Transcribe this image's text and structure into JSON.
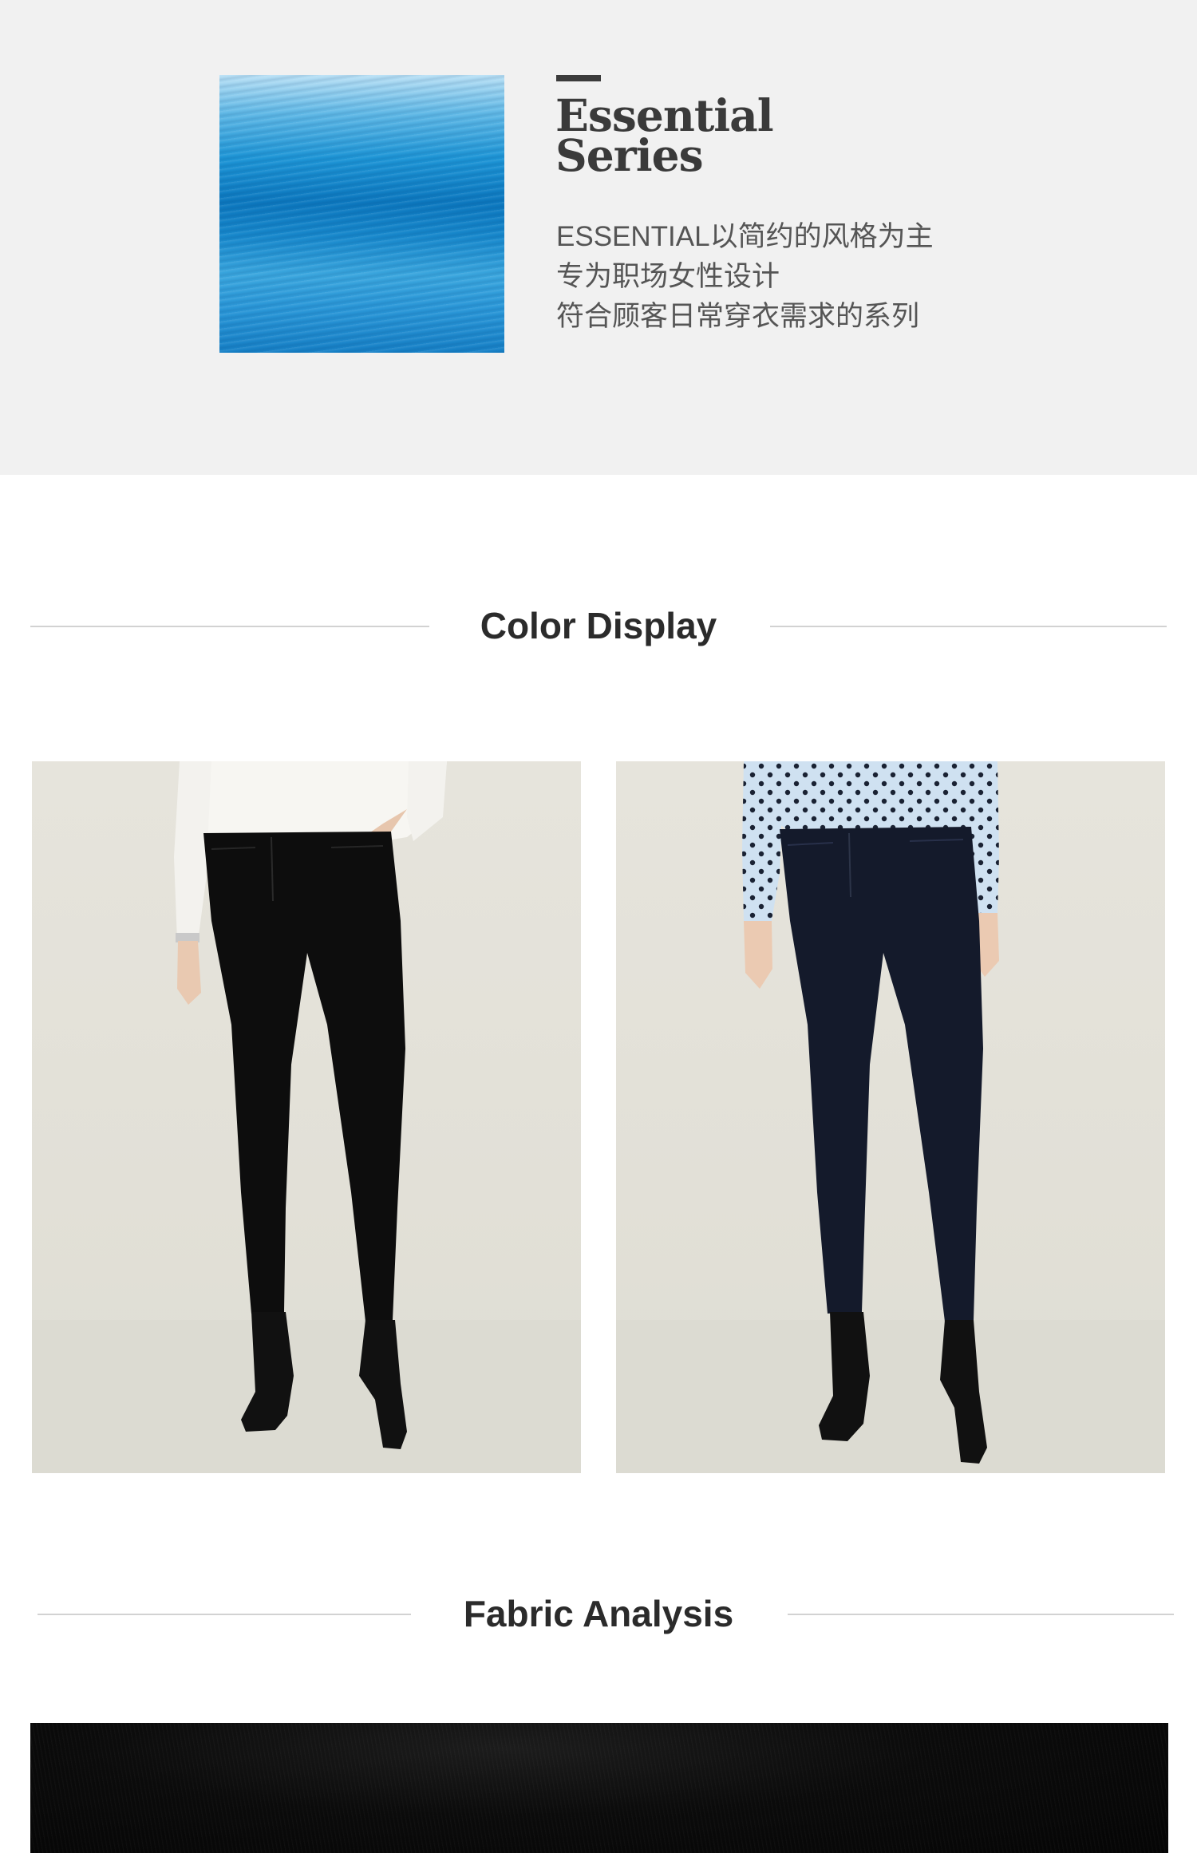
{
  "series": {
    "title_line1": "Essential",
    "title_line2": "Series",
    "description": [
      "ESSENTIAL以简约的风格为主",
      "专为职场女性设计",
      "符合顾客日常穿衣需求的系列"
    ],
    "swatch_color": "#1d95d6"
  },
  "color_display": {
    "heading": "Color Display",
    "variants": [
      {
        "pants_color": "#0d0d0d",
        "top": "white-blouse"
      },
      {
        "pants_color": "#141a2b",
        "top": "light-blue-polka-dot-blouse"
      }
    ]
  },
  "fabric_analysis": {
    "heading": "Fabric Analysis",
    "fabric_color": "#0b0b0b"
  }
}
